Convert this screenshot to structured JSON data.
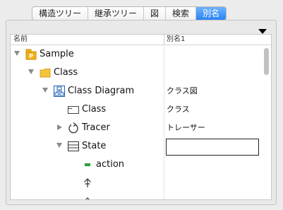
{
  "tabs": [
    {
      "label": "構造ツリー",
      "active": false
    },
    {
      "label": "継承ツリー",
      "active": false
    },
    {
      "label": "図",
      "active": false
    },
    {
      "label": "検索",
      "active": false
    },
    {
      "label": "別名",
      "active": true
    }
  ],
  "columns": {
    "name": "名前",
    "alias": "別名1"
  },
  "tree": [
    {
      "label": "Sample",
      "icon": "package-icon",
      "expanded": true,
      "alias": ""
    },
    {
      "label": "Class",
      "icon": "folder-icon",
      "expanded": true,
      "alias": ""
    },
    {
      "label": "Class Diagram",
      "icon": "class-diagram-icon",
      "expanded": true,
      "alias": "クラス図"
    },
    {
      "label": "Class",
      "icon": "class-icon",
      "expanded": null,
      "alias": "クラス"
    },
    {
      "label": "Tracer",
      "icon": "tracer-icon",
      "expanded": false,
      "alias": "トレーサー"
    },
    {
      "label": "State",
      "icon": "state-icon",
      "expanded": true,
      "alias": ""
    },
    {
      "label": "action",
      "icon": "action-icon",
      "expanded": null,
      "alias": ""
    },
    {
      "label": "",
      "icon": "arrow-up-icon",
      "expanded": null,
      "alias": ""
    },
    {
      "label": "",
      "icon": "caret-up-icon",
      "expanded": null,
      "alias": ""
    }
  ],
  "colors": {
    "accent": "#2b83f3",
    "package": "#f2b11c",
    "folder": "#f5c43d",
    "diagram": "#1f5fb8",
    "action": "#2e9e3a"
  }
}
